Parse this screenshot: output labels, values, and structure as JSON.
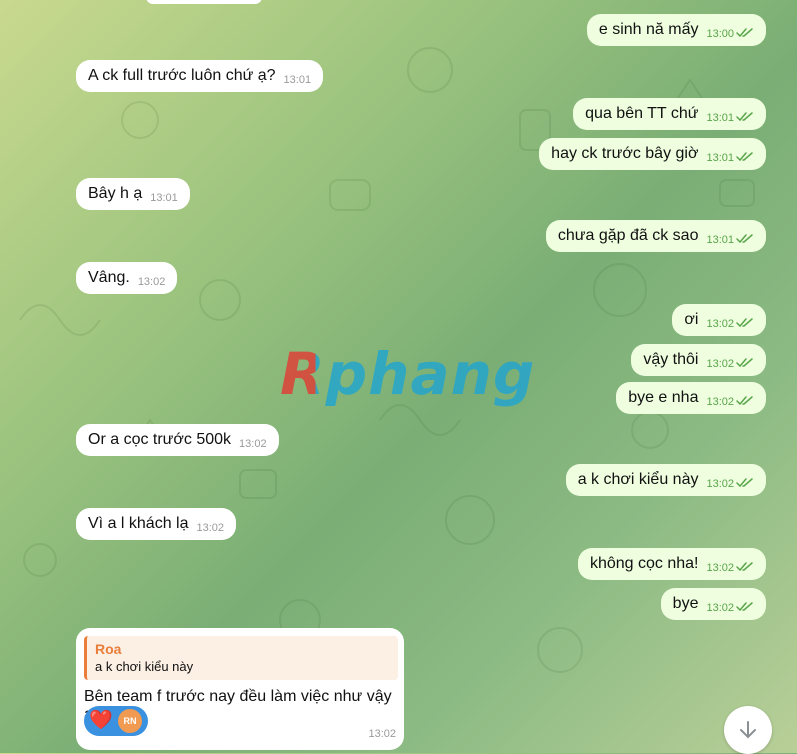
{
  "messages": [
    {
      "dir": "out",
      "text": "e sinh nă mấy",
      "time": "13:00"
    },
    {
      "dir": "in",
      "text": "A ck full trước luôn chứ ạ?",
      "time": "13:01"
    },
    {
      "dir": "out",
      "text": "qua bên TT chứ",
      "time": "13:01"
    },
    {
      "dir": "out",
      "text": "hay ck trước bây giờ",
      "time": "13:01"
    },
    {
      "dir": "in",
      "text": "Bây h ạ",
      "time": "13:01"
    },
    {
      "dir": "out",
      "text": "chưa gặp đã ck sao",
      "time": "13:01"
    },
    {
      "dir": "in",
      "text": "Vâng.",
      "time": "13:02"
    },
    {
      "dir": "out",
      "text": "ơi",
      "time": "13:02"
    },
    {
      "dir": "out",
      "text": "vậy thôi",
      "time": "13:02"
    },
    {
      "dir": "out",
      "text": "bye e nha",
      "time": "13:02"
    },
    {
      "dir": "in",
      "text": "Or a cọc trước 500k",
      "time": "13:02"
    },
    {
      "dir": "out",
      "text": "a k chơi kiểu này",
      "time": "13:02"
    },
    {
      "dir": "in",
      "text": "Vì a l khách lạ",
      "time": "13:02"
    },
    {
      "dir": "out",
      "text": "không cọc nha!",
      "time": "13:02"
    },
    {
      "dir": "out",
      "text": "bye",
      "time": "13:02"
    }
  ],
  "reply": {
    "quote_author": "Roa",
    "quote_text": "a k chơi kiểu này",
    "text": "Bên team f trước nay đều làm việc như vậy ạ",
    "time": "13:02",
    "reactions": [
      {
        "emoji": "❤️"
      },
      {
        "avatar_initials": "RN",
        "color": "#f19a52"
      }
    ]
  },
  "watermark": "Rphang",
  "icons": {
    "read_receipt": "double-check-icon",
    "scroll_down": "arrow-down-icon"
  },
  "colors": {
    "incoming": "#ffffff",
    "outgoing": "#eefedf",
    "time_out": "#5aa54a",
    "accent": "#e87e3a",
    "reaction_bg": "#3a91e0"
  }
}
